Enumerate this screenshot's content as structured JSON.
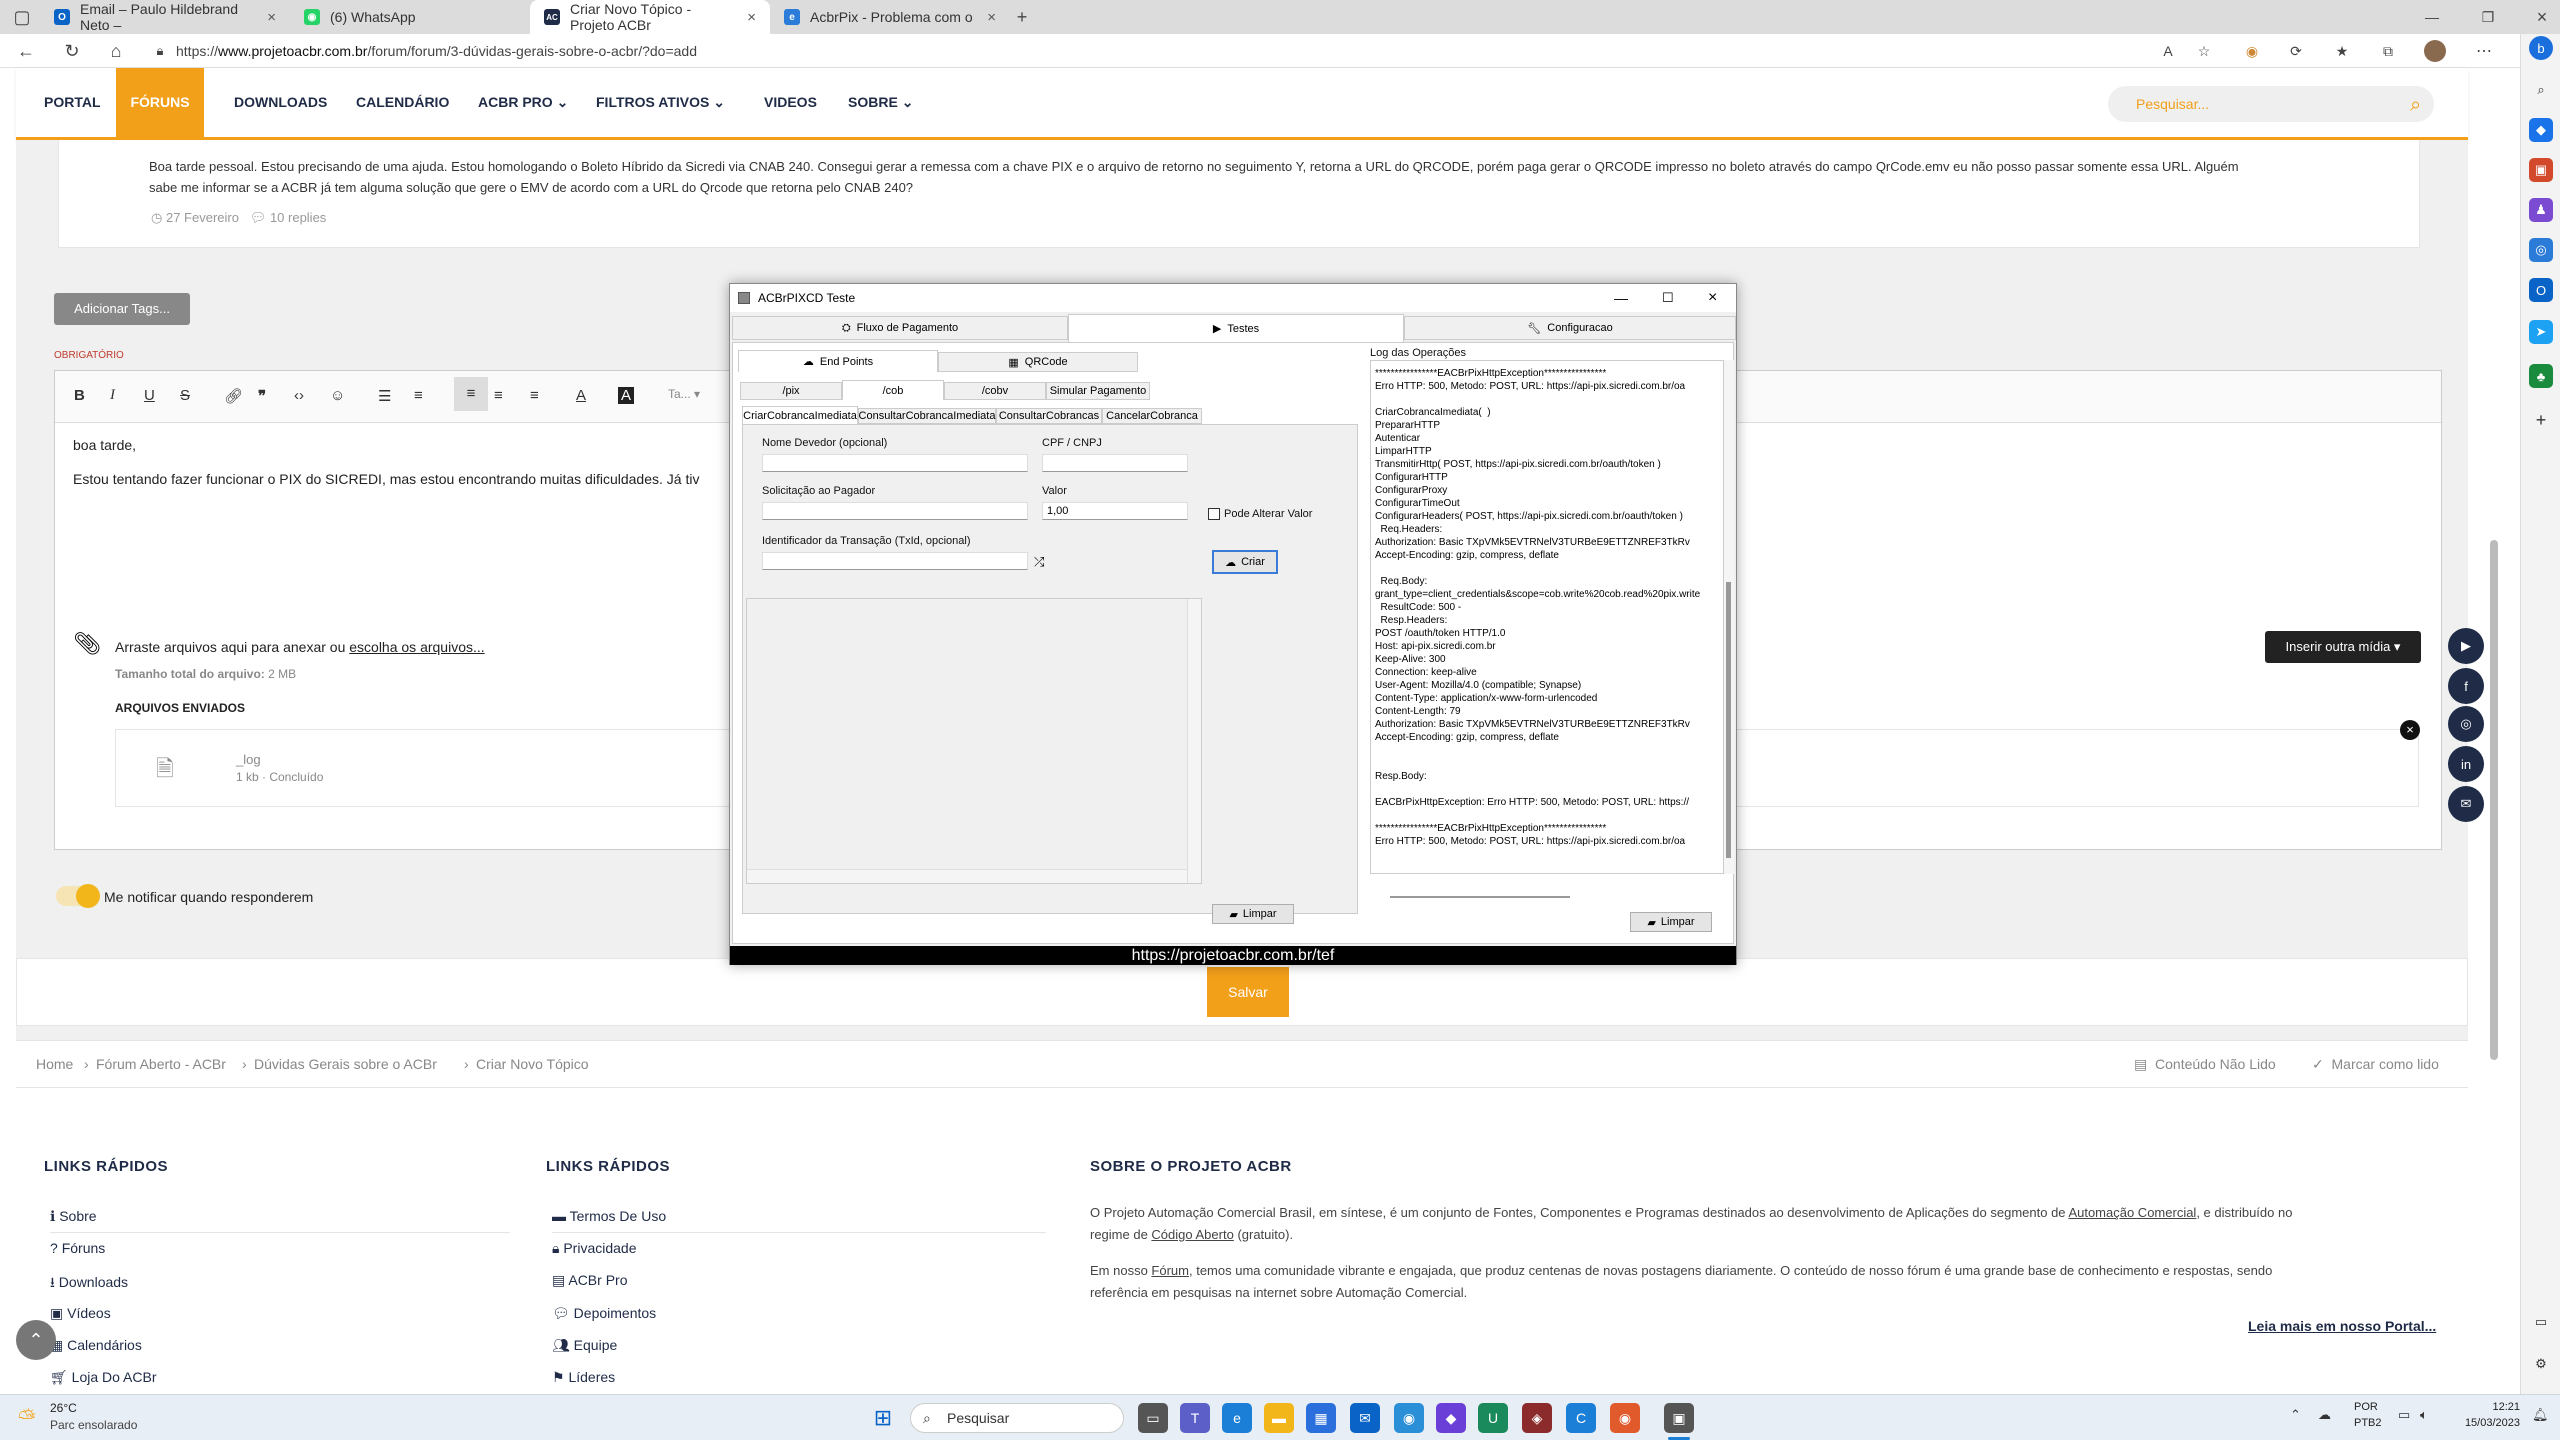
{
  "browser": {
    "tabs": [
      {
        "label": "Email – Paulo Hildebrand Neto –",
        "icon": "outlook-icon"
      },
      {
        "label": "(6) WhatsApp",
        "icon": "whatsapp-icon"
      },
      {
        "label": "Criar Novo Tópico - Projeto ACBr",
        "icon": "acbr-icon"
      },
      {
        "label": "AcbrPix - Problema com o Pix d",
        "icon": "edge-icon"
      }
    ],
    "url_prefix": "https://",
    "url_host": "www.projetoacbr.com.br",
    "url_path": "/forum/forum/3-dúvidas-gerais-sobre-o-acbr/?do=add"
  },
  "site": {
    "nav": [
      "PORTAL",
      "FÓRUNS",
      "DOWNLOADS",
      "CALENDÁRIO",
      "ACBR PRO",
      "FILTROS ATIVOS",
      "VIDEOS",
      "SOBRE"
    ],
    "active_nav": "FÓRUNS",
    "search_placeholder": "Pesquisar...",
    "accent": "#f29f1a",
    "navy": "#1f2b47"
  },
  "post": {
    "text1": "Boa tarde pessoal. Estou precisando de uma ajuda. Estou homologando o Boleto Híbrido da Sicredi via CNAB 240. Consegui gerar a remessa com a chave PIX e o arquivo de retorno no seguimento Y, retorna a URL do QRCODE, porém paga gerar o QRCODE impresso no boleto através do campo QrCode.emv eu não posso passar somente essa URL. Alguém",
    "text2": "sabe me informar se a ACBR já tem alguma solução que gere o EMV de acordo com a URL do Qrcode que retorna pelo CNAB 240?",
    "date": "27 Fevereiro",
    "replies": "10 replies"
  },
  "editor": {
    "add_tags": "Adicionar Tags...",
    "required": "OBRIGATÓRIO",
    "line1": "boa tarde,",
    "line2": "Estou tentando fazer funcionar o PIX do SICREDI, mas estou encontrando muitas dificuldades. Já tiv",
    "drop_text": "Arraste arquivos aqui para anexar ou ",
    "drop_link": "escolha os arquivos...",
    "total_label": "Tamanho total do arquivo:",
    "total_value": "2 MB",
    "sent_header": "ARQUIVOS ENVIADOS",
    "file_name": "_log",
    "file_status": "1 kb · Concluído",
    "insert_media": "Inserir outra mídia",
    "notify": "Me notificar quando responderem",
    "save": "Salvar",
    "font_label": "Ta..."
  },
  "breadcrumb": [
    "Home",
    "Fórum Aberto - ACBr",
    "Dúvidas Gerais sobre o ACBr",
    "Criar Novo Tópico"
  ],
  "breadcrumb_right": [
    "Conteúdo Não Lido",
    "Marcar como lido"
  ],
  "footer": {
    "col1_title": "LINKS RÁPIDOS",
    "col1": [
      "Sobre",
      "Fóruns",
      "Downloads",
      "Vídeos",
      "Calendários",
      "Loja Do ACBr"
    ],
    "col2_title": "LINKS RÁPIDOS",
    "col2": [
      "Termos De Uso",
      "Privacidade",
      "ACBr Pro",
      "Depoimentos",
      "Equipe",
      "Líderes"
    ],
    "col3_title": "SOBRE O PROJETO ACBR",
    "about1a": "O Projeto Automação Comercial Brasil, em síntese, é um conjunto de Fontes, Componentes e Programas destinados ao desenvolvimento de Aplicações do segmento de ",
    "about1link": "Automação Comercial",
    "about1b": ", e distribuído no",
    "about2a": "regime de ",
    "about2link": "Código Aberto",
    "about2b": " (gratuito).",
    "about3a": "Em nosso ",
    "about3link": "Fórum",
    "about3b": ", temos uma comunidade vibrante e engajada, que produz centenas de novas postagens diariamente. O conteúdo de nosso fórum é uma grande base de conhecimento e respostas, sendo",
    "about4": "referência em pesquisas na internet sobre Automação Comercial.",
    "read_more": "Leia mais em nosso Portal..."
  },
  "dialog": {
    "title": "ACBrPIXCD Teste",
    "main_tabs": [
      "Fluxo de Pagamento",
      "Testes",
      "Configuracao"
    ],
    "sub_tabs": [
      "End Points",
      "QRCode"
    ],
    "ep_tabs": [
      "/pix",
      "/cob",
      "/cobv",
      "Simular Pagamento"
    ],
    "cob_tabs": [
      "CriarCobrancaImediata",
      "ConsultarCobrancaImediata",
      "ConsultarCobrancas",
      "CancelarCobranca"
    ],
    "nome_label": "Nome Devedor (opcional)",
    "cpf_label": "CPF / CNPJ",
    "solic_label": "Solicitação ao Pagador",
    "valor_label": "Valor",
    "valor_value": "1,00",
    "pode_alterar": "Pode Alterar Valor",
    "txid_label": "Identificador da Transação (TxId, opcional)",
    "criar": "Criar",
    "limpar": "Limpar",
    "log_title": "Log das Operações",
    "log": "****************EACBrPixHttpException****************\nErro HTTP: 500, Metodo: POST, URL: https://api-pix.sicredi.com.br/oa\n\nCriarCobrancaImediata(  )\nPrepararHTTP\nAutenticar\nLimparHTTP\nTransmitirHttp( POST, https://api-pix.sicredi.com.br/oauth/token )\nConfigurarHTTP\nConfigurarProxy\nConfigurarTimeOut\nConfigurarHeaders( POST, https://api-pix.sicredi.com.br/oauth/token )\n  Req.Headers:\nAuthorization: Basic TXpVMk5EVTRNelV3TURBeE9ETTZNREF3TkRv\nAccept-Encoding: gzip, compress, deflate\n\n  Req.Body:\ngrant_type=client_credentials&scope=cob.write%20cob.read%20pix.write\n  ResultCode: 500 -\n  Resp.Headers:\nPOST /oauth/token HTTP/1.0\nHost: api-pix.sicredi.com.br\nKeep-Alive: 300\nConnection: keep-alive\nUser-Agent: Mozilla/4.0 (compatible; Synapse)\nContent-Type: application/x-www-form-urlencoded\nContent-Length: 79\nAuthorization: Basic TXpVMk5EVTRNelV3TURBeE9ETTZNREF3TkRv\nAccept-Encoding: gzip, compress, deflate\n\n\nResp.Body:\n\nEACBrPixHttpException: Erro HTTP: 500, Metodo: POST, URL: https://\n\n****************EACBrPixHttpException****************\nErro HTTP: 500, Metodo: POST, URL: https://api-pix.sicredi.com.br/oa",
    "footer_url": "https://projetoacbr.com.br/tef"
  },
  "taskbar": {
    "temp": "26°C",
    "weather": "Parc ensolarado",
    "search": "Pesquisar",
    "lang1": "POR",
    "lang2": "PTB2",
    "time": "12:21",
    "date": "15/03/2023"
  }
}
